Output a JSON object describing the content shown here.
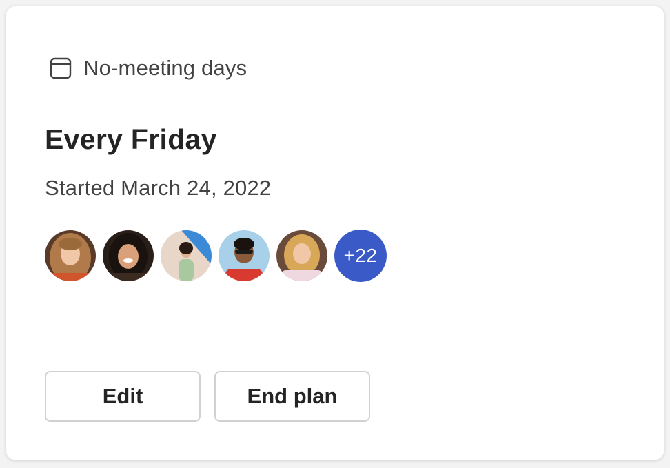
{
  "card": {
    "title": "No-meeting days",
    "icon": "calendar-icon",
    "schedule": "Every Friday",
    "started": "Started March 24, 2022"
  },
  "participants": {
    "avatars": [
      {
        "name": "avatar-1",
        "bg": "#7a4a30"
      },
      {
        "name": "avatar-2",
        "bg": "#3a2a20"
      },
      {
        "name": "avatar-3",
        "bg": "#4a8fd6"
      },
      {
        "name": "avatar-4",
        "bg": "#8fc0e0"
      },
      {
        "name": "avatar-5",
        "bg": "#6a4a3a"
      }
    ],
    "more_count": "+22",
    "more_color": "#3a5bc7"
  },
  "actions": {
    "edit_label": "Edit",
    "end_plan_label": "End plan"
  }
}
